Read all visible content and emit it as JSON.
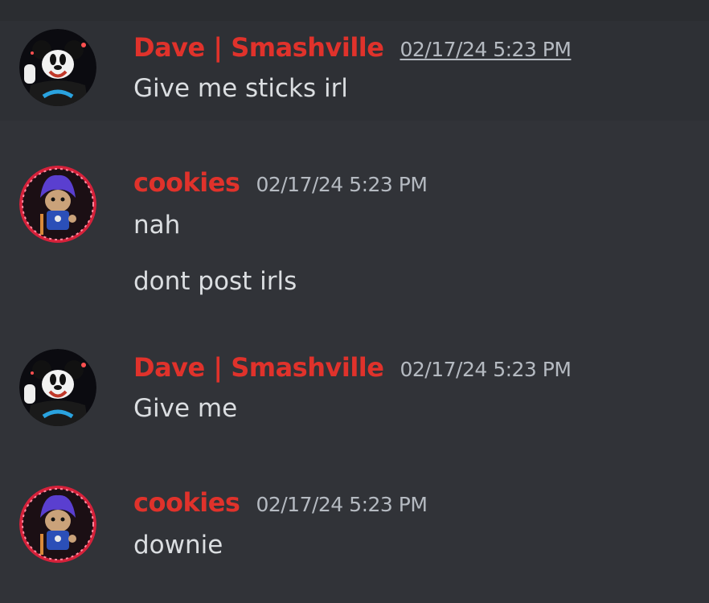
{
  "messages": [
    {
      "author": "Dave | Smashville",
      "timestamp": "02/17/24 5:23 PM",
      "lines": [
        "Give me sticks irl"
      ],
      "avatar_icon": "mickey-avatar-icon"
    },
    {
      "author": "cookies",
      "timestamp": "02/17/24 5:23 PM",
      "lines": [
        "nah",
        "dont post irls"
      ],
      "avatar_icon": "troll-doll-avatar-icon"
    },
    {
      "author": "Dave | Smashville",
      "timestamp": "02/17/24 5:23 PM",
      "lines": [
        "Give me"
      ],
      "avatar_icon": "mickey-avatar-icon"
    },
    {
      "author": "cookies",
      "timestamp": "02/17/24 5:23 PM",
      "lines": [
        "downie"
      ],
      "avatar_icon": "troll-doll-avatar-icon"
    }
  ],
  "colors": {
    "background": "#313338",
    "hover_background": "#2e3035",
    "username": "#e0322b",
    "timestamp": "#b5bac1",
    "message_text": "#dbdee1"
  }
}
